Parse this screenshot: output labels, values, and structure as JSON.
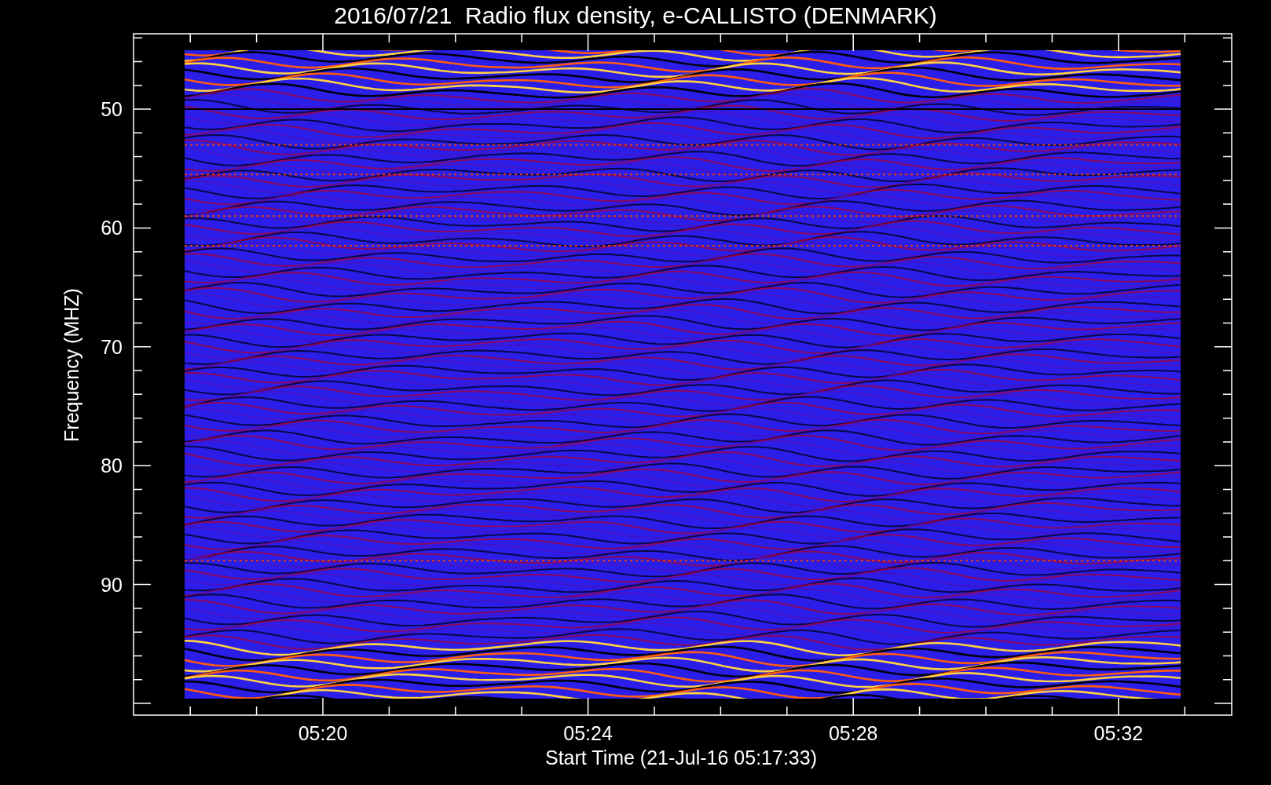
{
  "title": "2016/07/21  Radio flux density, e-CALLISTO (DENMARK)",
  "y_axis": {
    "label": "Frequency (MHZ)",
    "ticks": [
      "50",
      "60",
      "70",
      "80",
      "90"
    ]
  },
  "x_axis": {
    "label": "Start Time (21-Jul-16 05:17:33)",
    "ticks": [
      "05:20",
      "05:24",
      "05:28",
      "05:32"
    ]
  }
}
